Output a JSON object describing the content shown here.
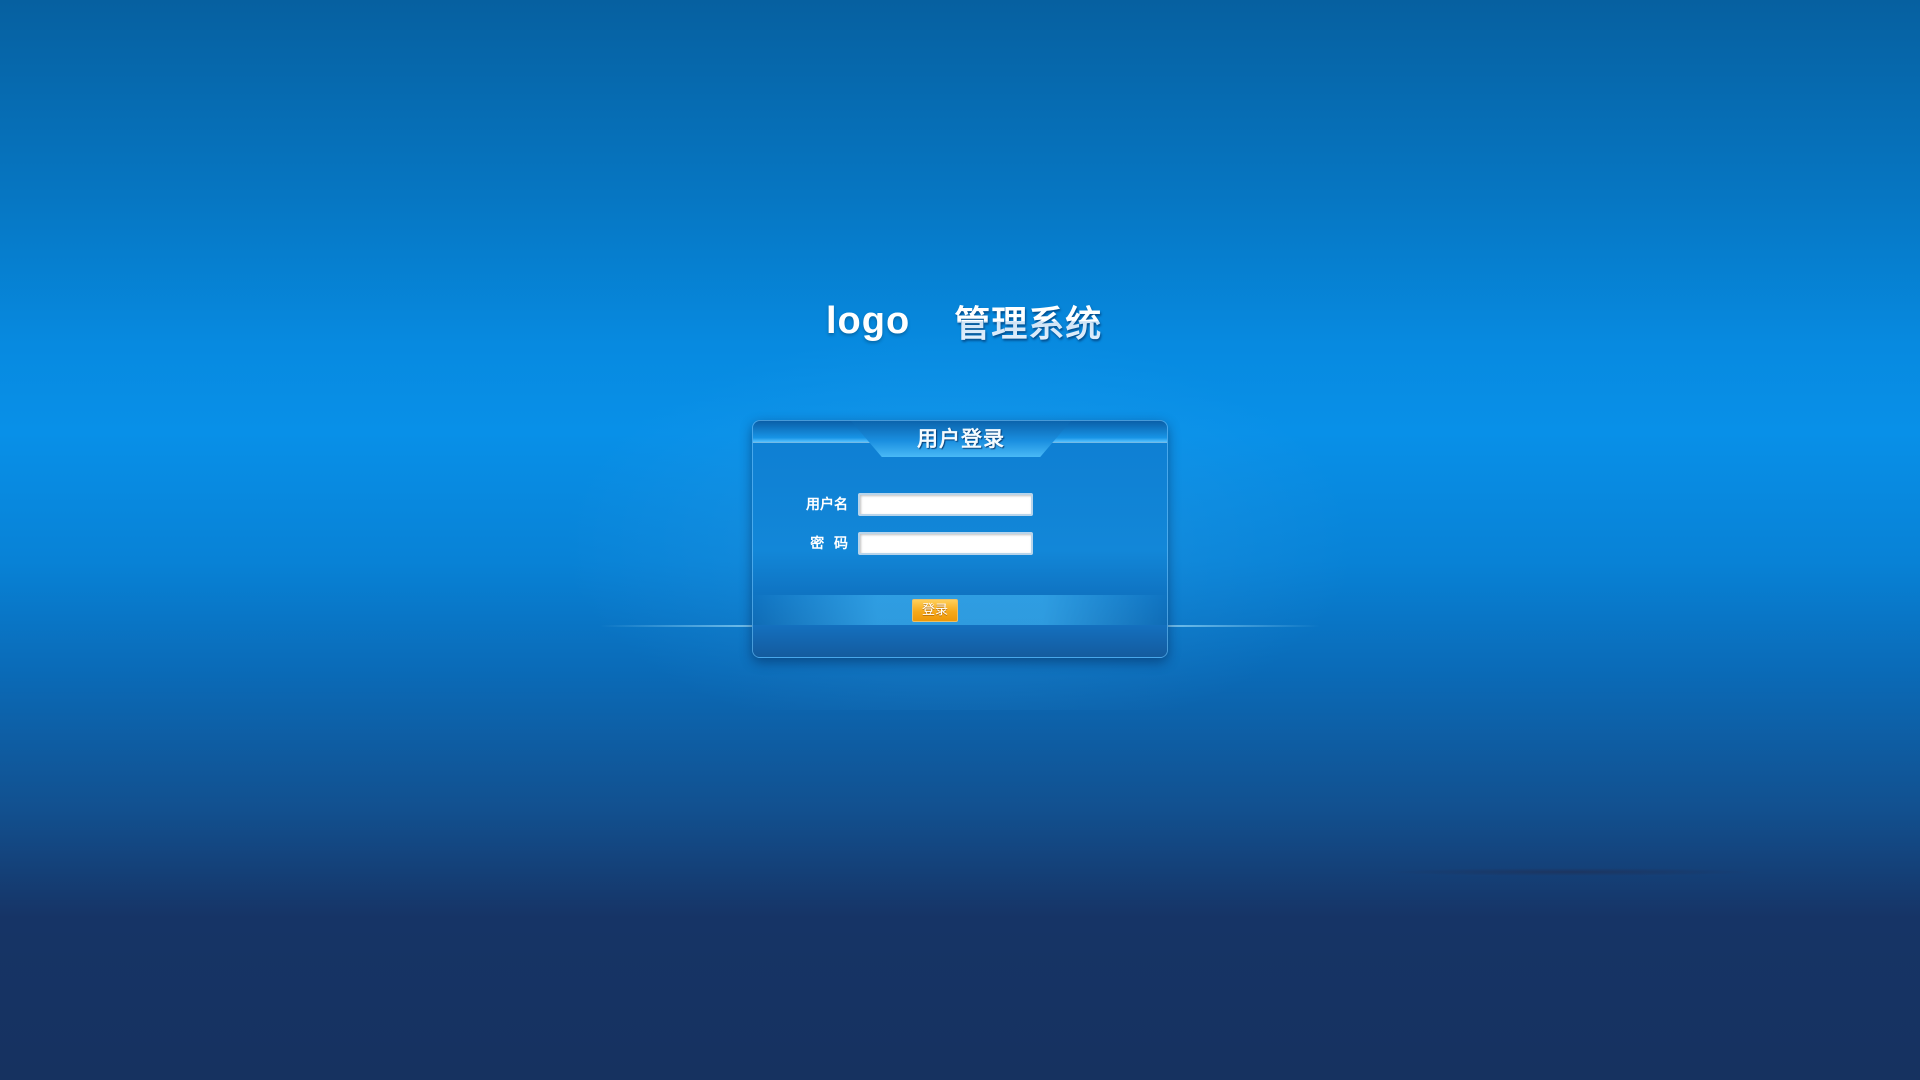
{
  "header": {
    "logo_text": "logo",
    "system_title": "管理系统"
  },
  "login_panel": {
    "title": "用户登录",
    "username_label": "用户名",
    "username_value": "",
    "password_label": "密  码",
    "password_value": "",
    "submit_label": "登录"
  },
  "colors": {
    "background_top": "#0660a0",
    "background_mid": "#0890e8",
    "background_bottom": "#163260",
    "panel": "#1287d8",
    "button": "#f6a91a"
  }
}
